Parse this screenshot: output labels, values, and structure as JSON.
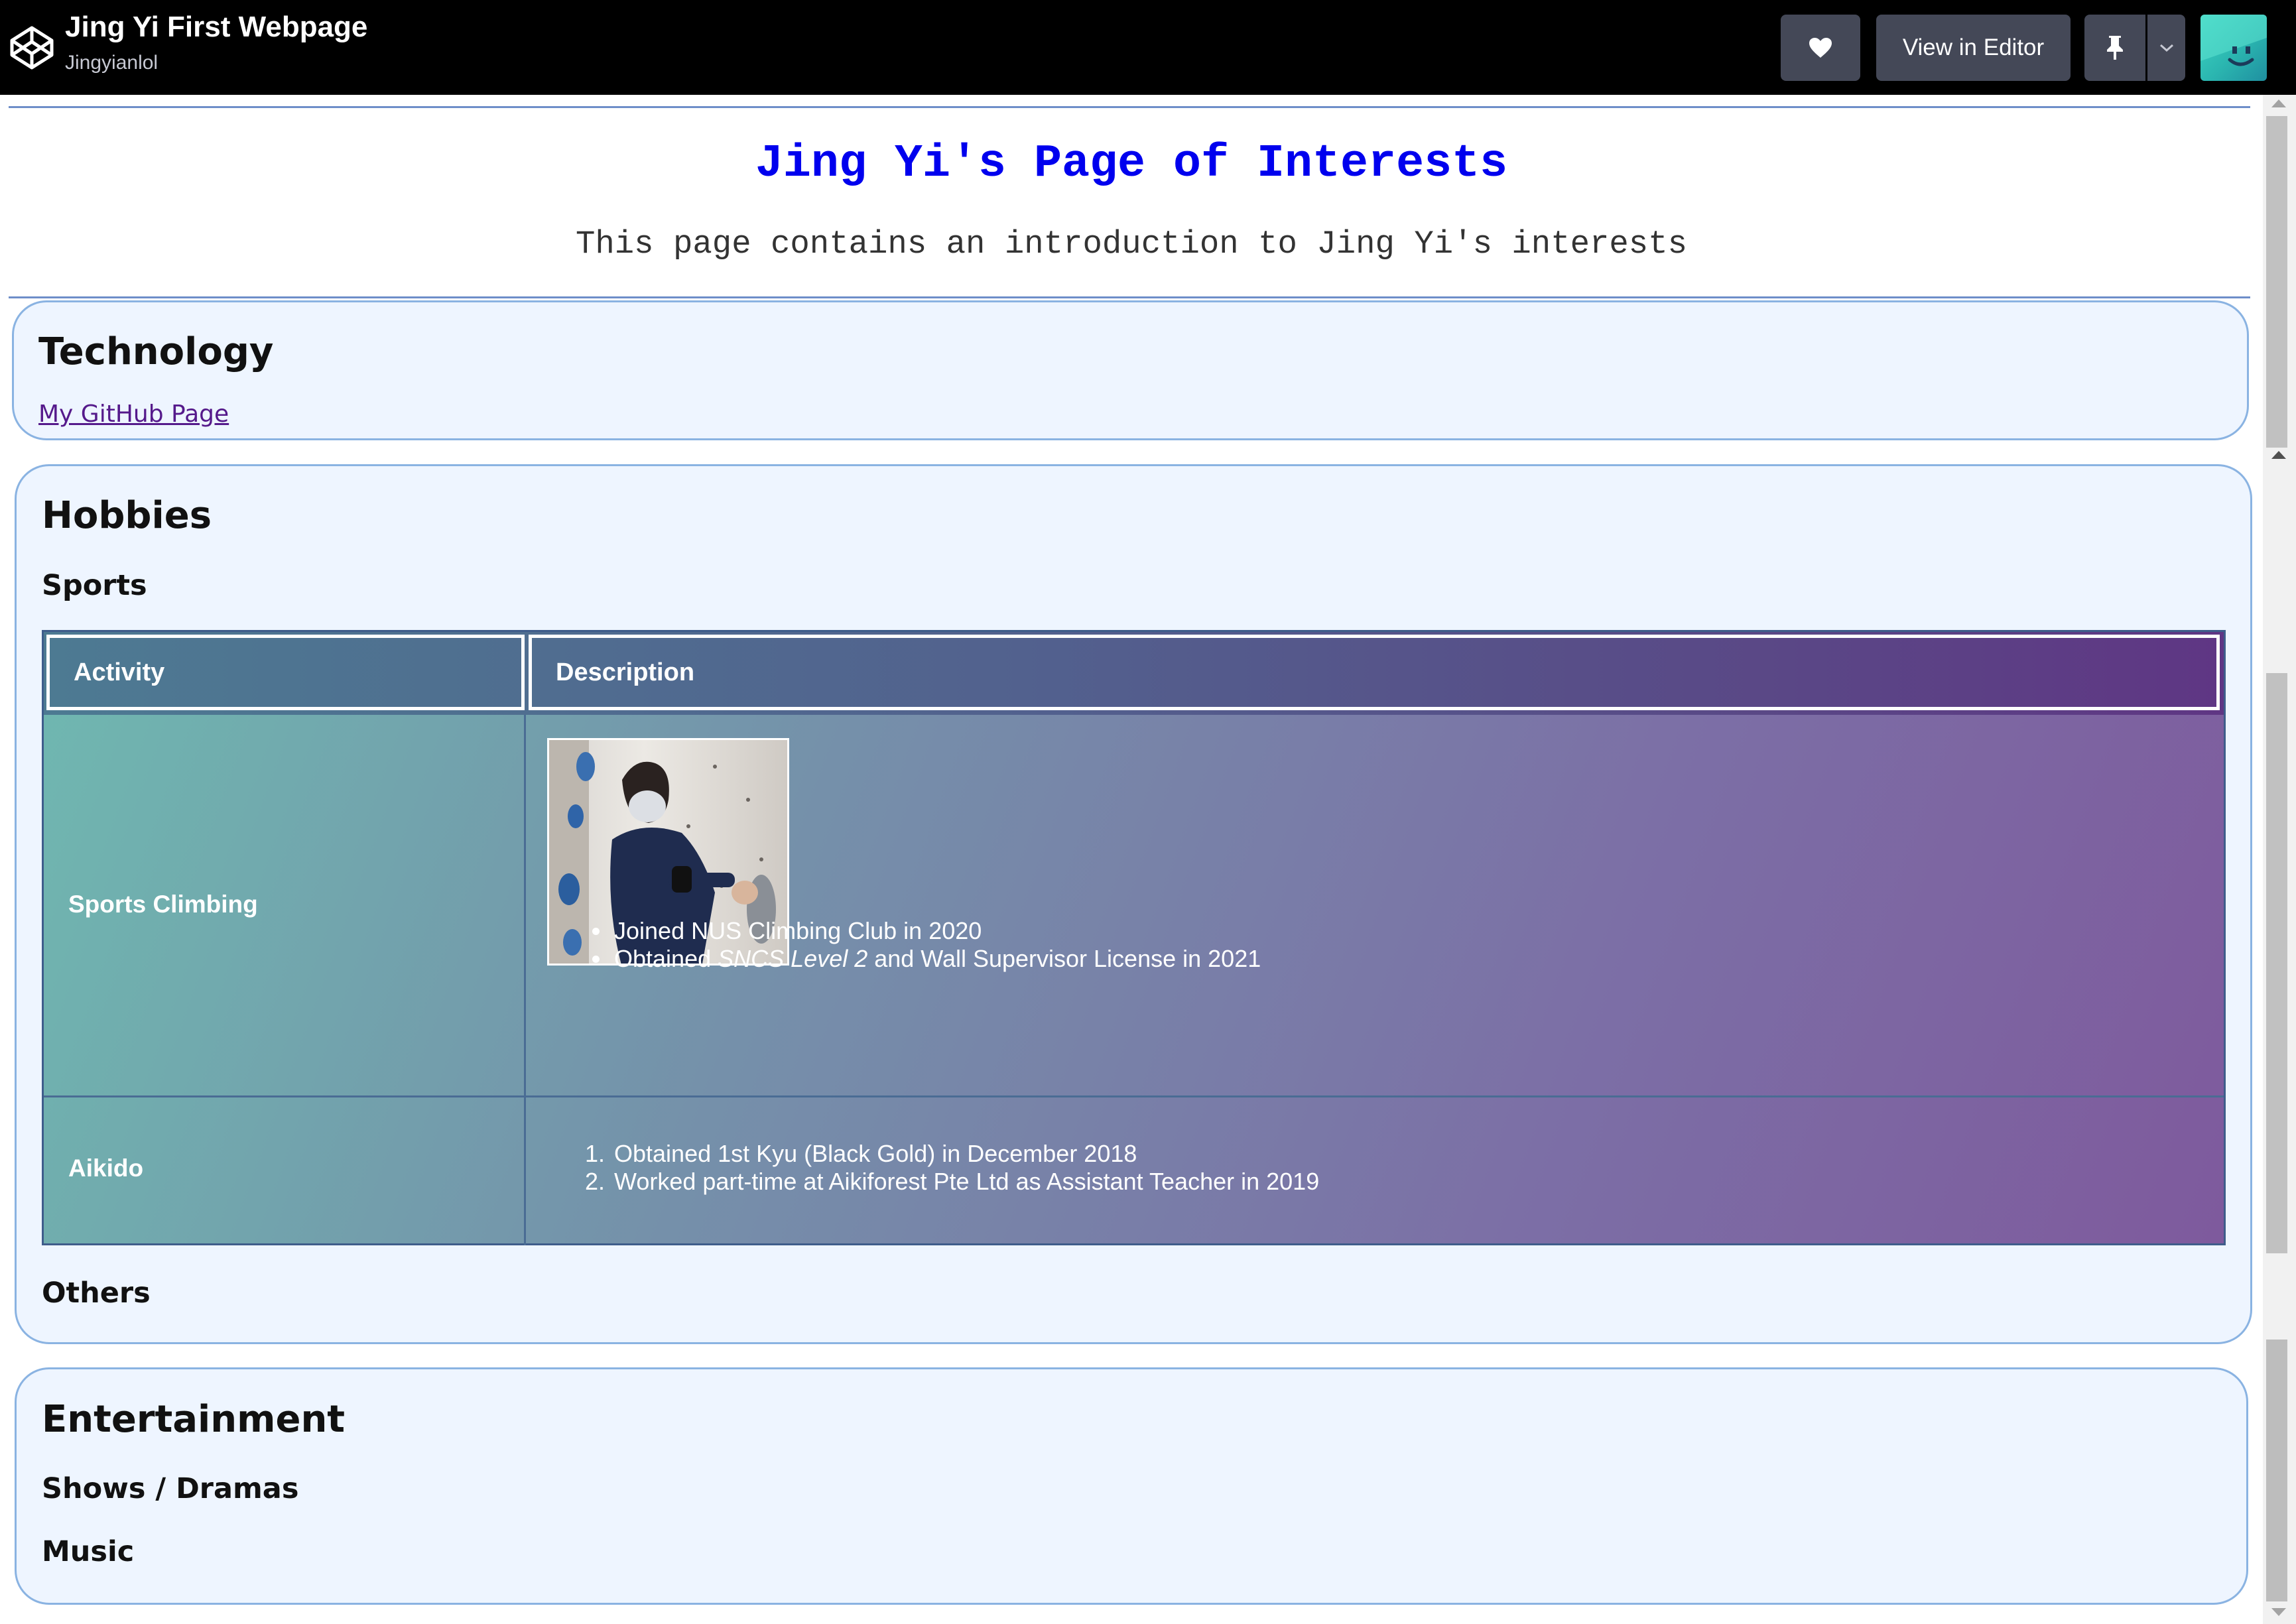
{
  "topbar": {
    "pen_title": "Jing Yi First Webpage",
    "author": "Jingyianlol",
    "view_in_editor_label": "View in Editor",
    "icons": [
      "codepen-logo-icon",
      "heart-icon",
      "pin-icon",
      "chevron-down-icon",
      "avatar"
    ]
  },
  "page": {
    "title": "Jing Yi's Page of Interests",
    "subtitle": "This page contains an introduction to Jing Yi's interests",
    "title_color": "#0000ee",
    "section_bg": "#eef5ff",
    "section_border": "#8ab3e2"
  },
  "technology": {
    "heading": "Technology",
    "link_label": "My GitHub Page"
  },
  "hobbies": {
    "heading": "Hobbies",
    "sports_heading": "Sports",
    "others_heading": "Others",
    "table": {
      "headers": [
        "Activity",
        "Description"
      ],
      "rows": [
        {
          "activity": "Sports Climbing",
          "items": [
            {
              "pre": "Joined NUS Climbing Club in 2020",
              "em": "",
              "post": ""
            },
            {
              "pre": "Obtained ",
              "em": "SNCS Level 2",
              "post": " and Wall Supervisor License in 2021"
            }
          ]
        },
        {
          "activity": "Aikido",
          "items": [
            "Obtained 1st Kyu (Black Gold) in December 2018",
            "Worked part-time at Aikiforest Pte Ltd as Assistant Teacher in 2019"
          ]
        }
      ]
    }
  },
  "entertainment": {
    "heading": "Entertainment",
    "shows_heading": "Shows / Dramas",
    "music_heading": "Music"
  }
}
